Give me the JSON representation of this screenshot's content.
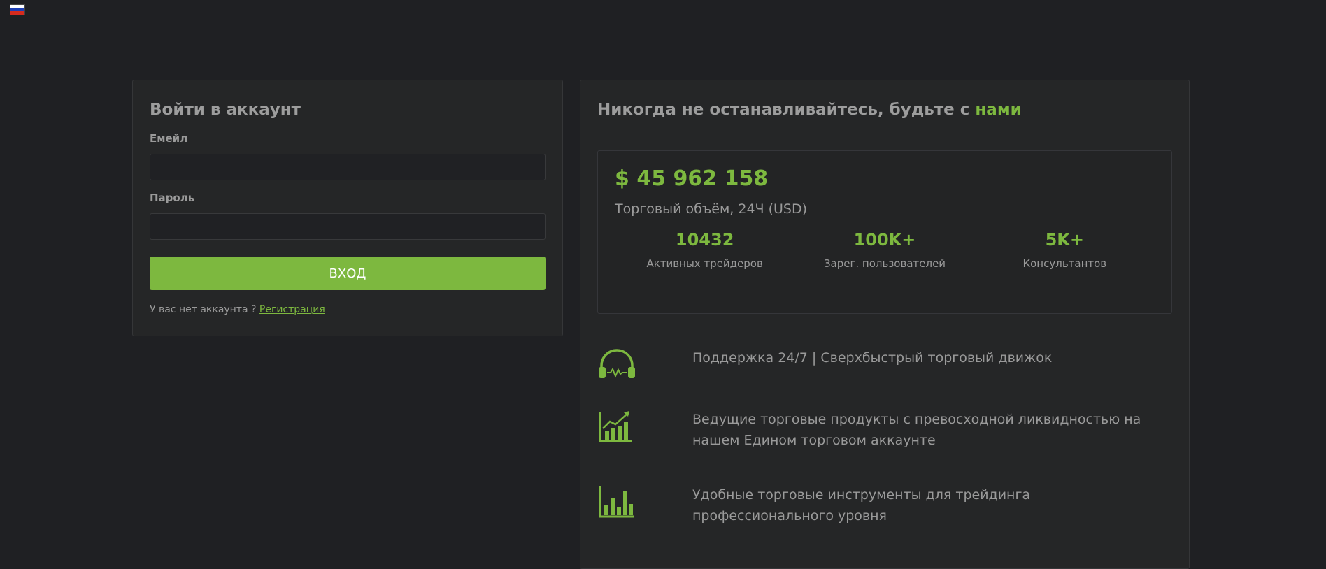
{
  "lang": {
    "flag_icon": "russia-flag-icon"
  },
  "login": {
    "title": "Войти в аккаунт",
    "email_label": "Емейл",
    "email_value": "",
    "password_label": "Пароль",
    "password_value": "",
    "submit_label": "ВХОД",
    "no_account_text": "У вас нет аккаунта ? ",
    "register_link": "Регистрация"
  },
  "info": {
    "title_main": "Никогда не останавливайтесь, будьте с ",
    "title_accent": "нами",
    "volume": "$ 45 962 158",
    "volume_label": "Торговый объём, 24Ч (USD)",
    "stats": [
      {
        "value": "10432",
        "label": "Активных трейдеров"
      },
      {
        "value": "100K+",
        "label": "Зарег. пользователей"
      },
      {
        "value": "5K+",
        "label": "Консультантов"
      }
    ],
    "features": [
      {
        "icon": "headphones-icon",
        "text": "Поддержка 24/7 | Сверхбыстрый торговый движок"
      },
      {
        "icon": "growth-chart-icon",
        "text": "Ведущие торговые продукты с превосходной ликвидностью на нашем Едином торговом аккаунте"
      },
      {
        "icon": "bar-chart-icon",
        "text": "Удобные торговые инструменты для трейдинга профессионального уровня"
      }
    ]
  },
  "colors": {
    "accent": "#7db83f",
    "background": "#1f2023",
    "card": "#252627"
  }
}
